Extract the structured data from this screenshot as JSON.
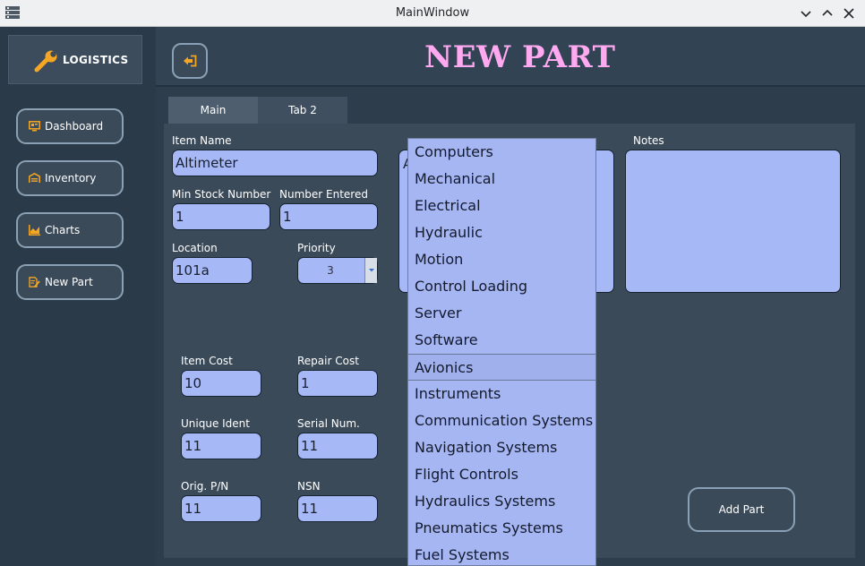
{
  "window": {
    "title": "MainWindow"
  },
  "sidebar": {
    "logo_text": "LOGISTICS",
    "items": [
      {
        "label": "Dashboard",
        "icon": "dashboard-icon"
      },
      {
        "label": "Inventory",
        "icon": "warehouse-icon"
      },
      {
        "label": "Charts",
        "icon": "chart-icon"
      },
      {
        "label": "New Part",
        "icon": "edit-document-icon"
      }
    ]
  },
  "header": {
    "title": "NEW PART"
  },
  "tabs": [
    {
      "label": "Main"
    },
    {
      "label": "Tab 2"
    }
  ],
  "form": {
    "item_name": {
      "label": "Item Name",
      "value": "Altimeter"
    },
    "min_stock": {
      "label": "Min Stock Number",
      "value": "1"
    },
    "number_entered": {
      "label": "Number Entered",
      "value": "1"
    },
    "location": {
      "label": "Location",
      "value": "101a"
    },
    "priority": {
      "label": "Priority",
      "value": "3"
    },
    "category_partial": "A",
    "notes": {
      "label": "Notes",
      "value": ""
    },
    "item_cost": {
      "label": "Item Cost",
      "value": "10"
    },
    "repair_cost": {
      "label": "Repair Cost",
      "value": "1"
    },
    "unique_ident": {
      "label": "Unique Ident",
      "value": "11"
    },
    "serial_num": {
      "label": "Serial Num.",
      "value": "11"
    },
    "orig_pn": {
      "label": "Orig. P/N",
      "value": "11"
    },
    "nsn": {
      "label": "NSN",
      "value": "11"
    },
    "add_button": "Add Part"
  },
  "dropdown": {
    "selected": "Avionics",
    "options": [
      "Computers",
      "Mechanical",
      "Electrical",
      "Hydraulic",
      "Motion",
      "Control Loading",
      "Server",
      "Software",
      "Avionics",
      "Instruments",
      "Communication Systems",
      "Navigation Systems",
      "Flight Controls",
      "Hydraulics Systems",
      "Pneumatics Systems",
      "Fuel Systems"
    ]
  },
  "colors": {
    "title_pink": "#ffaaf0",
    "field_bg": "#a7b8f6",
    "accent_orange": "#f5a623",
    "button_border": "#8aa1b5"
  }
}
